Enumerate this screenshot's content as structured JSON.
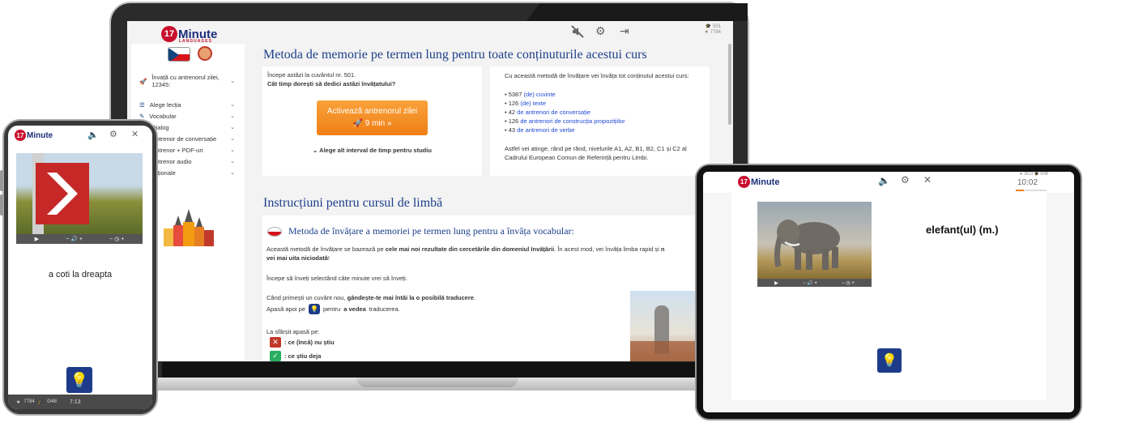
{
  "brand": {
    "number": "17",
    "name": "Minute",
    "sub": "LANGUAGES"
  },
  "laptop": {
    "stats": {
      "words": "501",
      "stars": "7784"
    },
    "sidebar": {
      "items": [
        {
          "label": "Învață cu antrenorul zilei, 12345:"
        },
        {
          "label": "Alege lecția"
        },
        {
          "label": "Vocabular"
        },
        {
          "label": "Dialog"
        },
        {
          "label": "Antrenor de conversație"
        },
        {
          "label": "Antrenor + PDF-uri"
        },
        {
          "label": "Antrenor audio"
        },
        {
          "label": "Opționale"
        }
      ]
    },
    "main_title": "Metoda de memorie pe termen lung pentru toate conținuturile acestui curs",
    "left_card": {
      "line1": "Începe astăzi la cuvântul nr. 501.",
      "line2": "Cât timp dorești să dedici astăzi învățatului?",
      "button_label": "Activează antrenorul zilei",
      "button_time": "9 min »",
      "alt_link": "Alege alt interval de timp pentru studiu"
    },
    "right_card": {
      "intro": "Cu această metodă de învățare vei învăța tot conținutul acestui curs:",
      "items": [
        {
          "count": "• 5387",
          "link": "(de) cuvinte"
        },
        {
          "count": "• 126",
          "link": "(de) texte"
        },
        {
          "count": "• 42",
          "link": "de antrenori de conversație"
        },
        {
          "count": "• 126",
          "link": "de antrenori de construcția propozițiilor"
        },
        {
          "count": "• 43",
          "link": "de antrenori de verbe"
        }
      ],
      "outro": "Astfel vei atinge, rând pe rând, nivelurile A1, A2, B1, B2, C1 și C2 al Cadrului European Comun de Referință pentru Limbi."
    },
    "instructions": {
      "title": "Instrucțiuni pentru cursul de limbă",
      "subtitle": "Metoda de învățare a memoriei pe termen lung pentru a învăța vocabular:",
      "p1_a": "Această metodă de învățare se bazează pe ",
      "p1_b": "cele mai noi rezultate din cercetările din domeniul învățării",
      "p1_c": ". În acest mod, vei învăța limba rapid și ",
      "p1_d": "n",
      "p1_e": "vei mai uita niciodată",
      "p1_f": "!",
      "p2": "Începe să înveți selectând câte minute vrei să înveți.",
      "p3_a": "Când primești un cuvânt nou, ",
      "p3_b": "gândește-te mai întâi la o posibilă traducere",
      "p3_c": ".",
      "p4_a": "Apasă apoi pe",
      "p4_b": "pentru",
      "p4_c": "a vedea",
      "p4_d": "traducerea.",
      "p5": "La sfârșit apasă pe:",
      "dontknow": ": ce (încă) nu știu",
      "know": ": ce știu deja"
    }
  },
  "phone": {
    "phrase": "a coti la dreapta",
    "stats_stars": "7784",
    "stats_progress": "0/48",
    "timer": "7:13"
  },
  "tablet": {
    "word": "elefant(ul) (m.)",
    "stats_stars": "3613",
    "stats_progress": "0/48",
    "timer": "10:02"
  },
  "colors": {
    "brand_blue": "#1c2f7a",
    "title_blue": "#1d3f8a",
    "orange": "#ef7f16",
    "red_x": "#c0392b",
    "green_check": "#27ae60"
  }
}
